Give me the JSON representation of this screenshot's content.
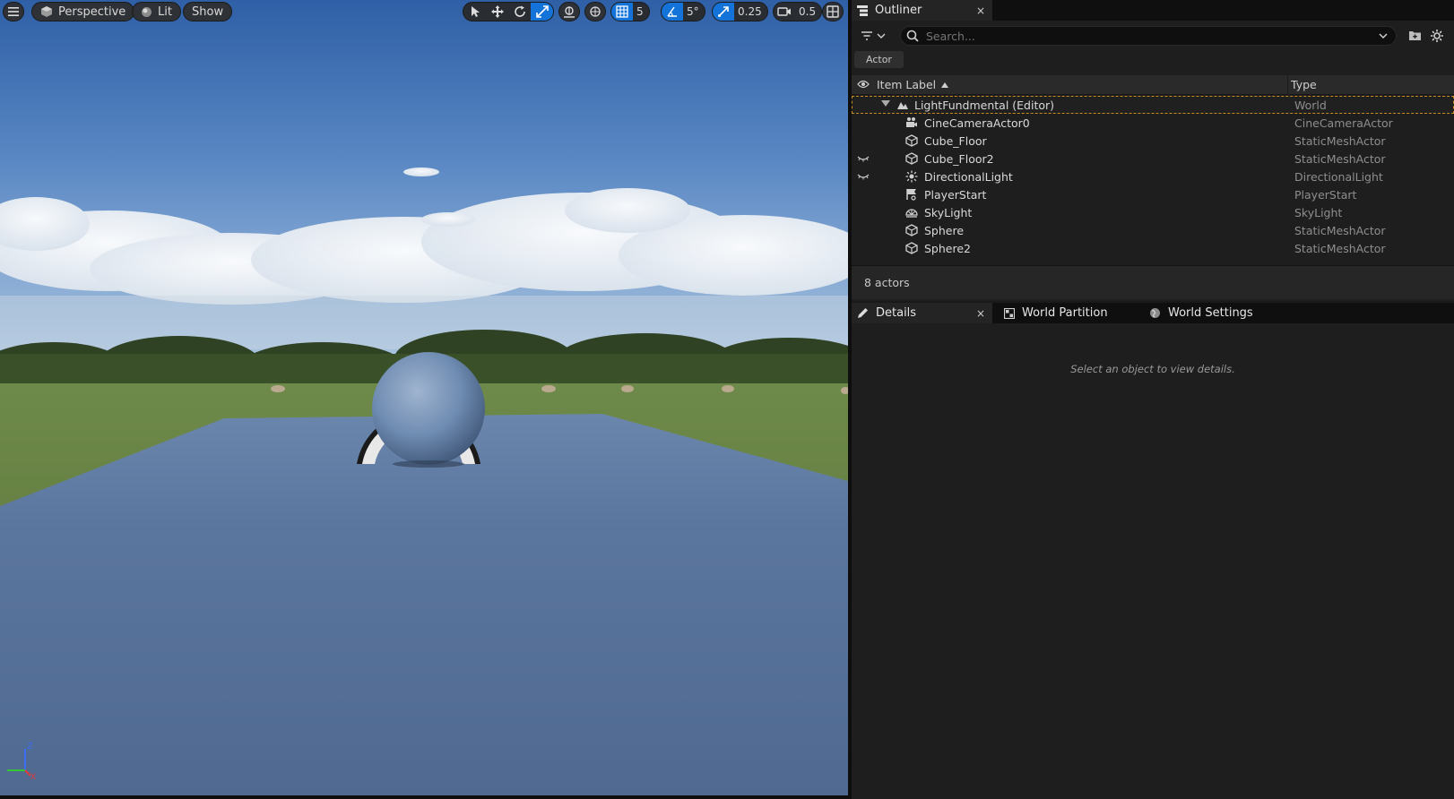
{
  "viewport": {
    "menu_icon": "hamburger-icon",
    "perspective_label": "Perspective",
    "lit_label": "Lit",
    "show_label": "Show",
    "grid_snap_value": "5",
    "rotation_snap_value": "5°",
    "scale_snap_value": "0.25",
    "camera_speed_value": "0.5",
    "axis_labels": {
      "z": "Z",
      "x": "X",
      "y": "Y"
    }
  },
  "outliner": {
    "tab_label": "Outliner",
    "close_glyph": "×",
    "search_placeholder": "Search...",
    "filter_chip": "Actor",
    "col_label": "Item Label",
    "col_type": "Type",
    "world": {
      "label": "LightFundmental (Editor)",
      "type": "World"
    },
    "items": [
      {
        "label": "CineCameraActor0",
        "type": "CineCameraActor",
        "icon": "camera-icon",
        "hidden_eye": false
      },
      {
        "label": "Cube_Floor",
        "type": "StaticMeshActor",
        "icon": "static-mesh-icon",
        "hidden_eye": false
      },
      {
        "label": "Cube_Floor2",
        "type": "StaticMeshActor",
        "icon": "static-mesh-icon",
        "hidden_eye": true
      },
      {
        "label": "DirectionalLight",
        "type": "DirectionalLight",
        "icon": "directional-light-icon",
        "hidden_eye": true
      },
      {
        "label": "PlayerStart",
        "type": "PlayerStart",
        "icon": "player-start-icon",
        "hidden_eye": false
      },
      {
        "label": "SkyLight",
        "type": "SkyLight",
        "icon": "sky-light-icon",
        "hidden_eye": false
      },
      {
        "label": "Sphere",
        "type": "StaticMeshActor",
        "icon": "static-mesh-icon",
        "hidden_eye": false
      },
      {
        "label": "Sphere2",
        "type": "StaticMeshActor",
        "icon": "static-mesh-icon",
        "hidden_eye": false
      }
    ],
    "actor_count": "8 actors"
  },
  "details": {
    "tabs": [
      {
        "label": "Details",
        "icon": "pencil-icon"
      },
      {
        "label": "World Partition",
        "icon": "world-partition-icon"
      },
      {
        "label": "World Settings",
        "icon": "globe-icon"
      }
    ],
    "empty_message": "Select an object to view details."
  },
  "colors": {
    "accent_blue": "#1473d8",
    "selection_outline": "#c78c1e",
    "panel_bg": "#1e1e1e"
  }
}
